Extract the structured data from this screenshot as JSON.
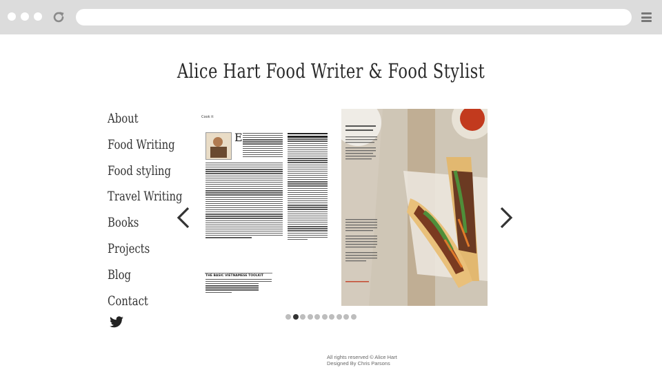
{
  "browser": {
    "dots": [
      "window-dot",
      "window-dot",
      "window-dot"
    ],
    "reload_icon": "reload-icon",
    "menu_icon": "hamburger-menu-icon",
    "url": ""
  },
  "header": {
    "title": "Alice Hart   Food Writer & Food Stylist"
  },
  "nav": {
    "items": [
      "About",
      "Food Writing",
      "Food styling",
      "Travel Writing",
      "Books",
      "Projects",
      "Blog",
      "Contact"
    ],
    "twitter_icon": "twitter-bird-icon"
  },
  "slider": {
    "left_page_label": "Cook it",
    "box_title": "THE BASIC VIETNAMESE TOOLKIT",
    "prev_icon": "chevron-left-icon",
    "next_icon": "chevron-right-icon",
    "total_pages": 10,
    "active_page": 2
  },
  "colors": {
    "chrome": "#dcdcdc",
    "text": "#333333",
    "dot_inactive": "#bdbdbd",
    "dot_active": "#333333"
  },
  "footer": {
    "rights": "All rights reserved © Alice Hart",
    "designer": "Designed By Chris Parsons"
  }
}
